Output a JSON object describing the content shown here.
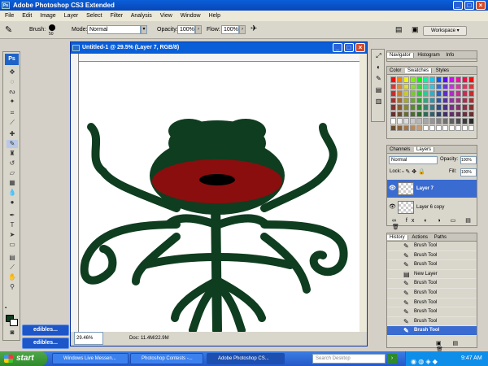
{
  "app": {
    "title": "Adobe Photoshop CS3 Extended",
    "ps_logo": "Ps"
  },
  "menu": [
    "File",
    "Edit",
    "Image",
    "Layer",
    "Select",
    "Filter",
    "Analysis",
    "View",
    "Window",
    "Help"
  ],
  "options": {
    "brush_label": "Brush:",
    "brush_size": "50",
    "mode_label": "Mode:",
    "mode_value": "Normal",
    "opacity_label": "Opacity:",
    "opacity_value": "100%",
    "flow_label": "Flow:",
    "flow_value": "100%",
    "workspace_label": "Workspace ▾"
  },
  "document": {
    "title": "Untitled-1 @ 29.5% (Layer 7, RGB/8)",
    "zoom": "29.46%",
    "doc_info": "Doc: 11.4M/22.9M"
  },
  "panels": {
    "navigator_tabs": [
      "Navigator",
      "Histogram",
      "Info"
    ],
    "color_tabs": [
      "Color",
      "Swatches",
      "Styles"
    ],
    "layers_tabs": [
      "Channels",
      "Layers"
    ],
    "blend_mode": "Normal",
    "opacity_label": "Opacity:",
    "opacity_value": "100%",
    "lock_label": "Lock:",
    "fill_label": "Fill:",
    "fill_value": "100%",
    "layers": [
      {
        "name": "Layer 7",
        "selected": true
      },
      {
        "name": "Layer 6 copy",
        "selected": false
      }
    ],
    "history_tabs": [
      "History",
      "Actions",
      "Paths"
    ],
    "history": [
      {
        "label": "Brush Tool",
        "selected": false
      },
      {
        "label": "Brush Tool",
        "selected": false
      },
      {
        "label": "Brush Tool",
        "selected": false
      },
      {
        "label": "New Layer",
        "selected": false
      },
      {
        "label": "Brush Tool",
        "selected": false
      },
      {
        "label": "Brush Tool",
        "selected": false
      },
      {
        "label": "Brush Tool",
        "selected": false
      },
      {
        "label": "Brush Tool",
        "selected": false
      },
      {
        "label": "Brush Tool",
        "selected": false
      },
      {
        "label": "Brush Tool",
        "selected": true
      }
    ]
  },
  "minimized": [
    "edibles...",
    "edibles..."
  ],
  "taskbar": {
    "start": "start",
    "items": [
      {
        "label": "Windows Live Messen...",
        "active": false
      },
      {
        "label": "Photoshop Contests -...",
        "active": false
      },
      {
        "label": "Adobe Photoshop CS...",
        "active": true
      }
    ],
    "search_placeholder": "Search Desktop",
    "clock": "9:47 AM"
  },
  "colors": {
    "foreground": "#0f3d1f",
    "background": "#ffffff",
    "plant_green": "#0f3d1f",
    "mouth_red": "#8a0e0e"
  }
}
